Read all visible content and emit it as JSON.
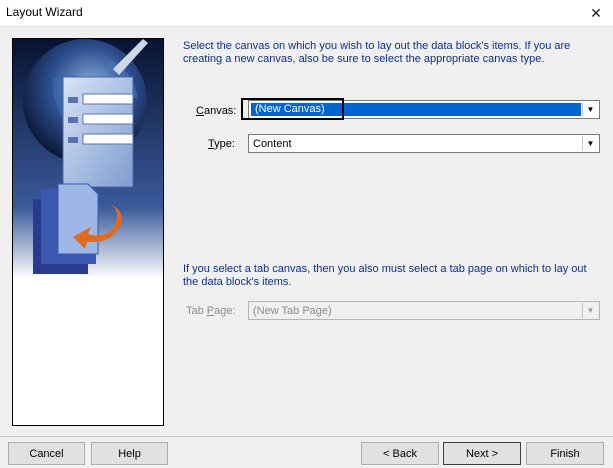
{
  "window": {
    "title": "Layout Wizard",
    "close_glyph": "✕"
  },
  "instructions": {
    "top": "Select the canvas on which you wish to lay out the data block's items. If you are creating a new canvas, also be sure to select the appropriate canvas type.",
    "tab": "If you select a tab canvas, then you also must select a tab page on which to lay out the data block's items."
  },
  "form": {
    "canvas": {
      "label_prefix": "",
      "label_accel": "C",
      "label_rest": "anvas:",
      "value": "(New Canvas)"
    },
    "type": {
      "label_accel": "T",
      "label_rest": "ype:",
      "value": "Content"
    },
    "tab_page": {
      "label_prefix": "Tab ",
      "label_accel": "P",
      "label_rest": "age:",
      "value": "(New Tab Page)"
    }
  },
  "buttons": {
    "cancel": "Cancel",
    "help": "Help",
    "back": "< Back",
    "next": "Next >",
    "finish": "Finish"
  },
  "colors": {
    "instruction_text": "#0b2f8a",
    "selection": "#0064d2"
  }
}
